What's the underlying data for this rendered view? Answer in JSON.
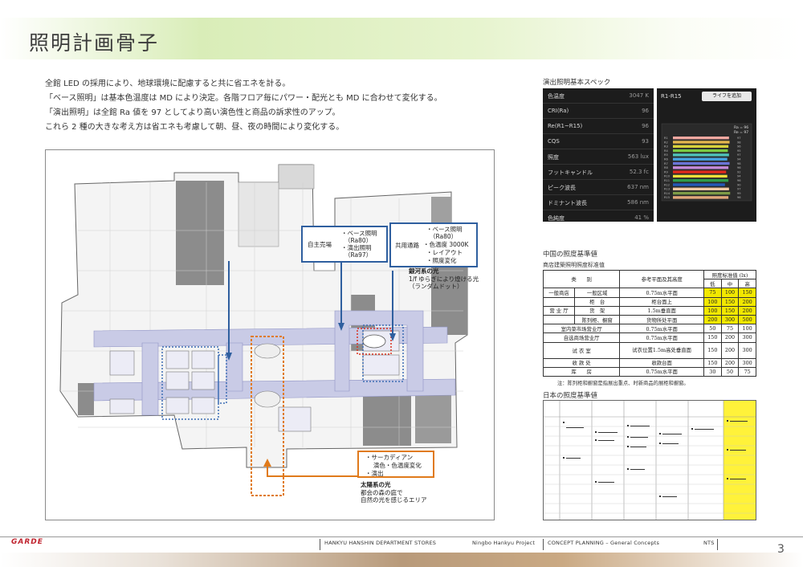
{
  "page": {
    "title": "照明計画骨子",
    "page_number": "3"
  },
  "intro": [
    "全館 LED の採用により、地球環境に配慮すると共に省エネを計る。",
    "「ベース照明」は基本色温度は MD により決定。各階フロア毎にパワー・配光とも MD に合わせて変化する。",
    "「演出照明」は全館 Ra 値を 97 としてより高い演色性と商品の訴求性のアップ。",
    "これら 2 種の大きな考え方は省エネも考慮して朝、昼、夜の時間により変化する。"
  ],
  "floor_plan": {
    "callout_left": {
      "title": "自主売場",
      "items": [
        "・ベース照明",
        "（Ra80）",
        "・演出照明",
        "（Ra97）"
      ]
    },
    "callout_right": {
      "title": "共用通路",
      "items": [
        "・ベース照明",
        "（Ra80）",
        "・色温度 3000K",
        "・レイアウト",
        "・照度変化"
      ]
    },
    "note_galaxy": {
      "title": "銀河系の光",
      "lines": [
        "1/f ゆらぎにより煌ける光",
        "（ランダムドット）"
      ]
    },
    "callout_bottom": {
      "items": [
        "・サーカディアン",
        "　 演色・色温度変化",
        "・演出"
      ]
    },
    "note_sun": {
      "title": "太陽系の光",
      "lines": [
        "都会の森の庭で",
        "自然の光を感じるエリア"
      ]
    },
    "colors": {
      "blue": "#2f5f9f",
      "orange": "#e07a1b",
      "gray": "#8c8c8c",
      "corridor": "#c9cbe6"
    }
  },
  "spec": {
    "title": "演出照明基本スペック",
    "rows": [
      {
        "label": "色温度",
        "value": "3047 K"
      },
      {
        "label": "CRI(Ra)",
        "value": "96"
      },
      {
        "label": "Re(R1~R15)",
        "value": "96"
      },
      {
        "label": "CQS",
        "value": "93"
      },
      {
        "label": "照度",
        "value": "563 lux"
      },
      {
        "label": "フットキャンドル",
        "value": "52.3 fc"
      },
      {
        "label": "ピーク波長",
        "value": "637 nm"
      },
      {
        "label": "ドミナント波長",
        "value": "586 nm"
      },
      {
        "label": "色純度",
        "value": "41 %"
      }
    ],
    "ri_panel": {
      "title": "R1-R15",
      "button": "ライフを追加",
      "legend": [
        "Ra = 96",
        "Re = 97"
      ],
      "bar_labels": [
        "R1",
        "R2",
        "R3",
        "R4",
        "R5",
        "R6",
        "R7",
        "R8",
        "R9",
        "R10",
        "R11",
        "R12",
        "R13",
        "R14",
        "R15"
      ],
      "bar_values": [
        97,
        98,
        96,
        95,
        97,
        94,
        98,
        96,
        92,
        94,
        96,
        90,
        97,
        99,
        96
      ],
      "bar_colors": [
        "#f2a7a0",
        "#e4b64e",
        "#d8d23c",
        "#7ac943",
        "#4fc1b9",
        "#46a3e0",
        "#6a74d6",
        "#c58ad8",
        "#e0281b",
        "#f0e03a",
        "#2e9b4a",
        "#2459b8",
        "#f2c9a6",
        "#7d9a46",
        "#e1a77b"
      ]
    }
  },
  "standards": {
    "title": "中国の照度基準値",
    "subtitle": "商店建築照明照度标准值",
    "header": {
      "category": "类　　别",
      "plane": "参考平面及其高度",
      "lux_title": "照度标准值 (lx)",
      "levels": [
        "低",
        "中",
        "高"
      ]
    },
    "rows": [
      {
        "group": "一般商店",
        "name": "一般区域",
        "plane": "0.75m水平面",
        "values": [
          "75",
          "100",
          "150"
        ],
        "highlight": true
      },
      {
        "group": "",
        "name": "柜　台",
        "plane": "柜台面上",
        "values": [
          "100",
          "150",
          "200"
        ],
        "highlight": true
      },
      {
        "group": "营 业 厅",
        "name": "货　架",
        "plane": "1.5m垂直面",
        "values": [
          "100",
          "150",
          "200"
        ],
        "highlight": true
      },
      {
        "group": "",
        "name": "陈列柜、橱窗",
        "plane": "货物所处平面",
        "values": [
          "200",
          "300",
          "500"
        ],
        "highlight": true
      },
      {
        "group": "室内菜市场营业厅",
        "name": "",
        "plane": "0.75m水平面",
        "values": [
          "50",
          "75",
          "100"
        ],
        "highlight": false
      },
      {
        "group": "自选商场营业厅",
        "name": "",
        "plane": "0.75m水平面",
        "values": [
          "150",
          "200",
          "300"
        ],
        "highlight": false
      },
      {
        "group": "试 衣 室",
        "name": "",
        "plane": "试衣位置1.5m高处垂直面",
        "values": [
          "150",
          "200",
          "300"
        ],
        "highlight": false
      },
      {
        "group": "收 款 处",
        "name": "",
        "plane": "收款台面",
        "values": [
          "150",
          "200",
          "300"
        ],
        "highlight": false
      },
      {
        "group": "库　　房",
        "name": "",
        "plane": "0.75m水平面",
        "values": [
          "30",
          "50",
          "75"
        ],
        "highlight": false
      }
    ],
    "note": "注：陈列柜和橱窗是指展出重点、时新商品的展柜和橱窗。"
  },
  "japan": {
    "title": "日本の照度基準値"
  },
  "footer": {
    "logo": "GARDE",
    "company": "HANKYU HANSHIN DEPARTMENT STORES",
    "project": "Ningbo Hankyu Project",
    "section": "CONCEPT PLANNING – General Concepts",
    "scale": "NTS"
  }
}
